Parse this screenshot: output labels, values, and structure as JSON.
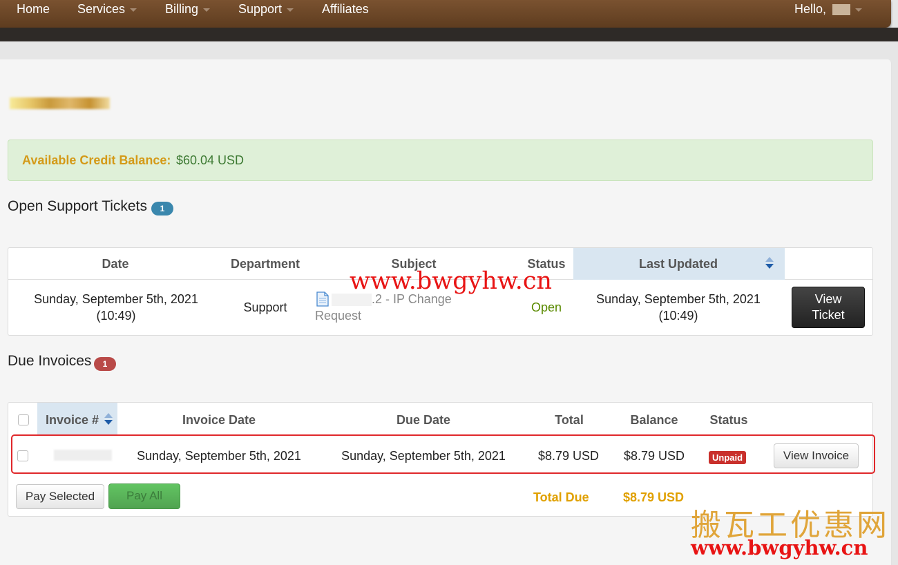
{
  "nav": {
    "home": "Home",
    "services": "Services",
    "billing": "Billing",
    "support": "Support",
    "affiliates": "Affiliates",
    "hello": "Hello, "
  },
  "credit": {
    "label": "Available Credit Balance:",
    "value": "$60.04 USD"
  },
  "tickets": {
    "title": "Open Support Tickets",
    "count": "1",
    "headers": [
      "Date",
      "Department",
      "Subject",
      "Status",
      "Last Updated"
    ],
    "row": {
      "date_line1": "Sunday, September 5th, 2021",
      "date_line2": "(10:49)",
      "department": "Support",
      "subject_line1": ".2 - IP Change",
      "subject_line2": "Request",
      "status": "Open",
      "updated_line1": "Sunday, September 5th, 2021",
      "updated_line2": "(10:49)",
      "view_line1": "View",
      "view_line2": "Ticket"
    }
  },
  "invoices": {
    "title": "Due Invoices",
    "count": "1",
    "headers": [
      "Invoice #",
      "Invoice Date",
      "Due Date",
      "Total",
      "Balance",
      "Status"
    ],
    "row": {
      "invoice_date": "Sunday, September 5th, 2021",
      "due_date": "Sunday, September 5th, 2021",
      "total": "$8.79 USD",
      "balance": "$8.79 USD",
      "status": "Unpaid",
      "view": "View Invoice"
    },
    "pay_selected": "Pay Selected",
    "pay_all": "Pay All",
    "total_due_label": "Total Due",
    "total_due_value": "$8.79 USD"
  },
  "watermarks": {
    "url_center": "www.bwgyhw.cn",
    "cn": "搬瓦工优惠网",
    "url_corner": "www.bwgyhw.cn"
  },
  "colors": {
    "nav_bg": "#6e4a2a",
    "credit_label": "#d49a18",
    "credit_value": "#3d7a33",
    "status_open": "#5a8a00",
    "unpaid": "#c9302c",
    "total_due": "#e0a000"
  }
}
